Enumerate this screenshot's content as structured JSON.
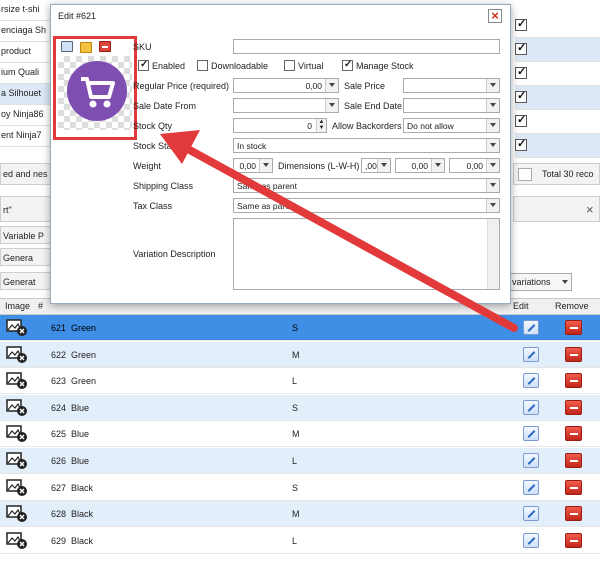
{
  "background": {
    "left_rows": [
      "rsize t-shi",
      "enciaga Sh",
      "product",
      "ium Quali",
      "a Silhouet",
      "oy Ninja86",
      "ent Ninja7",
      "",
      "ed and nes",
      "rt\"",
      "Variable P",
      "Genera",
      "Generat"
    ],
    "total_label": "Total 30 reco",
    "variations_label": "variations"
  },
  "dialog": {
    "title": "Edit #621",
    "close_icon": "close-icon",
    "fields": {
      "sku_label": "SKU",
      "sku_value": "",
      "enabled_label": "Enabled",
      "downloadable_label": "Downloadable",
      "virtual_label": "Virtual",
      "manage_stock_label": "Manage Stock",
      "regular_price_label": "Regular Price (required)",
      "regular_price_value": "0,00",
      "sale_price_label": "Sale Price",
      "sale_price_value": "",
      "sale_date_from_label": "Sale Date From",
      "sale_date_from_value": "",
      "sale_end_date_label": "Sale End Date",
      "sale_end_date_value": "",
      "stock_qty_label": "Stock Qty",
      "stock_qty_value": "0",
      "allow_backorders_label": "Allow Backorders",
      "allow_backorders_value": "Do not allow",
      "stock_status_label": "Stock Status",
      "stock_status_value": "In stock",
      "weight_label": "Weight",
      "weight_value": "0,00",
      "dimensions_label": "Dimensions (L-W-H)",
      "dim_l": ",00",
      "dim_w": "0,00",
      "dim_h": "0,00",
      "shipping_class_label": "Shipping Class",
      "shipping_class_value": "Same as parent",
      "tax_class_label": "Tax Class",
      "tax_class_value": "Same as parent",
      "variation_description_label": "Variation Description"
    },
    "checkboxes": {
      "enabled": true,
      "downloadable": false,
      "virtual": false,
      "manage_stock": true
    }
  },
  "table": {
    "headers": {
      "image": "Image",
      "id": "#",
      "edit": "Edit",
      "remove": "Remove"
    },
    "rows": [
      {
        "id": "621",
        "color": "Green",
        "size": "S"
      },
      {
        "id": "622",
        "color": "Green",
        "size": "M"
      },
      {
        "id": "623",
        "color": "Green",
        "size": "L"
      },
      {
        "id": "624",
        "color": "Blue",
        "size": "S"
      },
      {
        "id": "625",
        "color": "Blue",
        "size": "M"
      },
      {
        "id": "626",
        "color": "Blue",
        "size": "L"
      },
      {
        "id": "627",
        "color": "Black",
        "size": "S"
      },
      {
        "id": "628",
        "color": "Black",
        "size": "M"
      },
      {
        "id": "629",
        "color": "Black",
        "size": "L"
      }
    ]
  },
  "colors": {
    "accent_red": "#e23a3a",
    "selected_row": "#3f8fe6",
    "alt_row": "#e3eefb",
    "logo_purple": "#7e4fb0"
  }
}
